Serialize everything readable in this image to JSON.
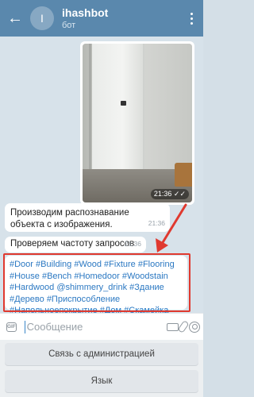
{
  "header": {
    "back_glyph": "←",
    "avatar_letter": "I",
    "title": "ihashbot",
    "subtitle": "бот"
  },
  "chat": {
    "photo": {
      "time": "21:36 ✓✓"
    },
    "messages": [
      {
        "text": "Производим распознавание объекта с изображения.",
        "time": "21:36"
      },
      {
        "text": "Проверяем частоту запросов",
        "time": "21:36"
      }
    ],
    "hashtags": "#Door #Building #Wood #Fixture #Flooring #House #Bench #Homedoor #Woodstain #Hardwood @shimmery_drink #Здание #Дерево #Приспособление #Напольноепокрытие #Дом #Скамейка"
  },
  "input": {
    "gif_label": "GIF",
    "placeholder": "Сообщение"
  },
  "keyboard": {
    "buttons": [
      {
        "label": "Связь с администрацией"
      },
      {
        "label": "Язык"
      }
    ]
  },
  "colors": {
    "header": "#5a88ad",
    "link": "#2b78c2",
    "highlight": "#e0392f"
  }
}
